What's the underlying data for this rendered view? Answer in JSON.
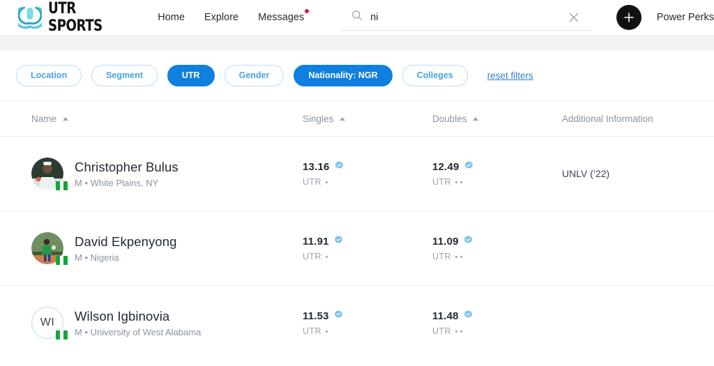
{
  "header": {
    "logo_text": "UTR SPORTS",
    "logo_icon": "utr-u-logo-icon",
    "nav": [
      {
        "label": "Home",
        "has_dot": false
      },
      {
        "label": "Explore",
        "has_dot": false
      },
      {
        "label": "Messages",
        "has_dot": true
      }
    ],
    "search": {
      "icon": "search-icon",
      "value": "ni",
      "placeholder": "Search",
      "clear_icon": "close-icon"
    },
    "add_button": {
      "icon": "plus-icon",
      "bg": "#111111"
    },
    "power_perks_label": "Power Perks"
  },
  "filters": {
    "chips": [
      {
        "label": "Location",
        "active": false
      },
      {
        "label": "Segment",
        "active": false
      },
      {
        "label": "UTR",
        "active": true
      },
      {
        "label": "Gender",
        "active": false
      },
      {
        "label": "Nationality: NGR",
        "active": true
      },
      {
        "label": "Colleges",
        "active": false
      }
    ],
    "reset_label": "reset filters",
    "active_color": "#0f7fe0",
    "inactive_text_color": "#4aa3e0"
  },
  "table": {
    "columns": [
      {
        "label": "Name",
        "sortable": true
      },
      {
        "label": "Singles",
        "sortable": true
      },
      {
        "label": "Doubles",
        "sortable": true
      },
      {
        "label": "Additional Information",
        "sortable": false
      }
    ],
    "unit_label": "UTR",
    "rows": [
      {
        "avatar_type": "photo",
        "initials": "",
        "name": "Christopher Bulus",
        "sub": "M • White Plains, NY",
        "singles": "13.16",
        "singles_dots": 1,
        "doubles": "12.49",
        "doubles_dots": 2,
        "extra": "UNLV (’22)",
        "verified": true,
        "flag": "NGR"
      },
      {
        "avatar_type": "photo",
        "initials": "",
        "name": "David Ekpenyong",
        "sub": "M • Nigeria",
        "singles": "11.91",
        "singles_dots": 1,
        "doubles": "11.09",
        "doubles_dots": 2,
        "extra": "",
        "verified": true,
        "flag": "NGR"
      },
      {
        "avatar_type": "initials",
        "initials": "WI",
        "name": "Wilson Igbinovia",
        "sub": "M • University of West Alabama",
        "singles": "11.53",
        "singles_dots": 1,
        "doubles": "11.48",
        "doubles_dots": 2,
        "extra": "",
        "verified": true,
        "flag": "NGR"
      }
    ]
  }
}
